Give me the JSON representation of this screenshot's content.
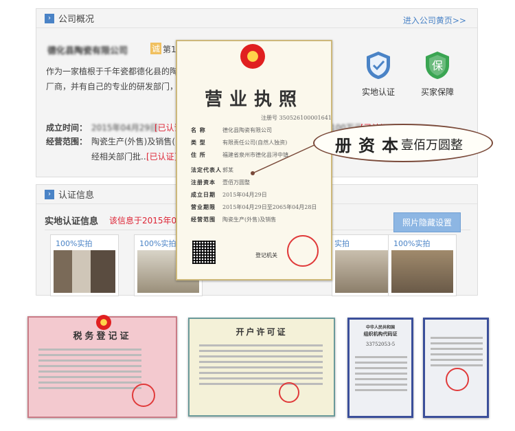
{
  "overview": {
    "title": "公司概况",
    "more_link": "进入公司黄页>>",
    "company_name": "德化县陶瓷有限公司",
    "cert_mark": "诚",
    "year_prefix": "第1",
    "intro_1": "作为一家植根于千年瓷都德化县的陶瓷",
    "intro_2": "厂商，并有自己的专业的研发部门，不",
    "founded_label": "成立时间：",
    "founded_value": "2015年04月29日",
    "verified": "[已认证]",
    "capital_value": "100万元",
    "scope_label": "经营范围：",
    "scope_value": "陶瓷生产(外售)及销售(",
    "scope_value_2": "经相关部门批...",
    "badge_onsite": "实地认证",
    "badge_protect": "买家保障",
    "badge_protect_glyph": "保"
  },
  "certification": {
    "title": "认证信息",
    "tab_onsite": "实地认证信息",
    "tab_note": "该信息于2015年04",
    "hide_button": "照片隐藏设置",
    "photo_tag": "100%实拍",
    "photo_tag_short": "实拍"
  },
  "license": {
    "title": "营业执照",
    "reg_no_label": "注册号",
    "reg_no": "350526100001641",
    "rows": [
      {
        "k": "名 称",
        "v": "德化县陶瓷有限公司"
      },
      {
        "k": "类 型",
        "v": "有限责任公司(自然人独资)"
      },
      {
        "k": "住 所",
        "v": "福建省泉州市德化县浔中镇"
      },
      {
        "k": "法定代表人",
        "v": "郭某"
      },
      {
        "k": "注册资本",
        "v": "壹佰万圆整"
      },
      {
        "k": "成立日期",
        "v": "2015年04月29日"
      },
      {
        "k": "营业期限",
        "v": "2015年04月29日至2065年04月28日"
      },
      {
        "k": "经营范围",
        "v": "陶瓷生产(外售)及销售"
      }
    ],
    "authority": "登记机关",
    "callout_key": "册资本",
    "callout_value": "壹佰万圆整"
  },
  "docs": {
    "tax_title": "税务登记证",
    "account_title": "开户许可证",
    "org_header_1": "中华人民共和国",
    "org_header_2": "组织机构代码证",
    "org_code": "33752053-5"
  },
  "colors": {
    "accent": "#4a83c6",
    "red": "#d23"
  }
}
